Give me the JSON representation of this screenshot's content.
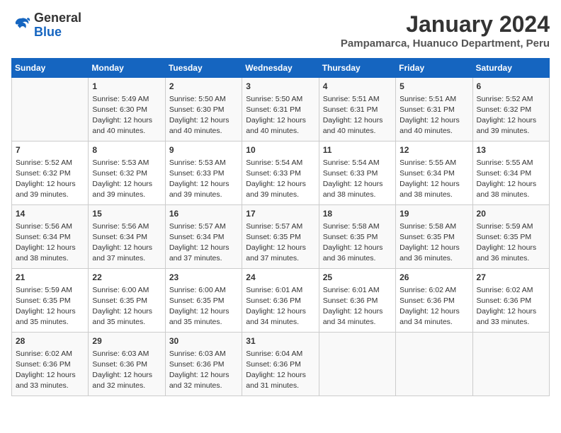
{
  "logo": {
    "general": "General",
    "blue": "Blue"
  },
  "title": {
    "month_year": "January 2024",
    "location": "Pampamarca, Huanuco Department, Peru"
  },
  "days_of_week": [
    "Sunday",
    "Monday",
    "Tuesday",
    "Wednesday",
    "Thursday",
    "Friday",
    "Saturday"
  ],
  "weeks": [
    [
      {
        "day": "",
        "content": ""
      },
      {
        "day": "1",
        "content": "Sunrise: 5:49 AM\nSunset: 6:30 PM\nDaylight: 12 hours\nand 40 minutes."
      },
      {
        "day": "2",
        "content": "Sunrise: 5:50 AM\nSunset: 6:30 PM\nDaylight: 12 hours\nand 40 minutes."
      },
      {
        "day": "3",
        "content": "Sunrise: 5:50 AM\nSunset: 6:31 PM\nDaylight: 12 hours\nand 40 minutes."
      },
      {
        "day": "4",
        "content": "Sunrise: 5:51 AM\nSunset: 6:31 PM\nDaylight: 12 hours\nand 40 minutes."
      },
      {
        "day": "5",
        "content": "Sunrise: 5:51 AM\nSunset: 6:31 PM\nDaylight: 12 hours\nand 40 minutes."
      },
      {
        "day": "6",
        "content": "Sunrise: 5:52 AM\nSunset: 6:32 PM\nDaylight: 12 hours\nand 39 minutes."
      }
    ],
    [
      {
        "day": "7",
        "content": "Sunrise: 5:52 AM\nSunset: 6:32 PM\nDaylight: 12 hours\nand 39 minutes."
      },
      {
        "day": "8",
        "content": "Sunrise: 5:53 AM\nSunset: 6:32 PM\nDaylight: 12 hours\nand 39 minutes."
      },
      {
        "day": "9",
        "content": "Sunrise: 5:53 AM\nSunset: 6:33 PM\nDaylight: 12 hours\nand 39 minutes."
      },
      {
        "day": "10",
        "content": "Sunrise: 5:54 AM\nSunset: 6:33 PM\nDaylight: 12 hours\nand 39 minutes."
      },
      {
        "day": "11",
        "content": "Sunrise: 5:54 AM\nSunset: 6:33 PM\nDaylight: 12 hours\nand 38 minutes."
      },
      {
        "day": "12",
        "content": "Sunrise: 5:55 AM\nSunset: 6:34 PM\nDaylight: 12 hours\nand 38 minutes."
      },
      {
        "day": "13",
        "content": "Sunrise: 5:55 AM\nSunset: 6:34 PM\nDaylight: 12 hours\nand 38 minutes."
      }
    ],
    [
      {
        "day": "14",
        "content": "Sunrise: 5:56 AM\nSunset: 6:34 PM\nDaylight: 12 hours\nand 38 minutes."
      },
      {
        "day": "15",
        "content": "Sunrise: 5:56 AM\nSunset: 6:34 PM\nDaylight: 12 hours\nand 37 minutes."
      },
      {
        "day": "16",
        "content": "Sunrise: 5:57 AM\nSunset: 6:34 PM\nDaylight: 12 hours\nand 37 minutes."
      },
      {
        "day": "17",
        "content": "Sunrise: 5:57 AM\nSunset: 6:35 PM\nDaylight: 12 hours\nand 37 minutes."
      },
      {
        "day": "18",
        "content": "Sunrise: 5:58 AM\nSunset: 6:35 PM\nDaylight: 12 hours\nand 36 minutes."
      },
      {
        "day": "19",
        "content": "Sunrise: 5:58 AM\nSunset: 6:35 PM\nDaylight: 12 hours\nand 36 minutes."
      },
      {
        "day": "20",
        "content": "Sunrise: 5:59 AM\nSunset: 6:35 PM\nDaylight: 12 hours\nand 36 minutes."
      }
    ],
    [
      {
        "day": "21",
        "content": "Sunrise: 5:59 AM\nSunset: 6:35 PM\nDaylight: 12 hours\nand 35 minutes."
      },
      {
        "day": "22",
        "content": "Sunrise: 6:00 AM\nSunset: 6:35 PM\nDaylight: 12 hours\nand 35 minutes."
      },
      {
        "day": "23",
        "content": "Sunrise: 6:00 AM\nSunset: 6:35 PM\nDaylight: 12 hours\nand 35 minutes."
      },
      {
        "day": "24",
        "content": "Sunrise: 6:01 AM\nSunset: 6:36 PM\nDaylight: 12 hours\nand 34 minutes."
      },
      {
        "day": "25",
        "content": "Sunrise: 6:01 AM\nSunset: 6:36 PM\nDaylight: 12 hours\nand 34 minutes."
      },
      {
        "day": "26",
        "content": "Sunrise: 6:02 AM\nSunset: 6:36 PM\nDaylight: 12 hours\nand 34 minutes."
      },
      {
        "day": "27",
        "content": "Sunrise: 6:02 AM\nSunset: 6:36 PM\nDaylight: 12 hours\nand 33 minutes."
      }
    ],
    [
      {
        "day": "28",
        "content": "Sunrise: 6:02 AM\nSunset: 6:36 PM\nDaylight: 12 hours\nand 33 minutes."
      },
      {
        "day": "29",
        "content": "Sunrise: 6:03 AM\nSunset: 6:36 PM\nDaylight: 12 hours\nand 32 minutes."
      },
      {
        "day": "30",
        "content": "Sunrise: 6:03 AM\nSunset: 6:36 PM\nDaylight: 12 hours\nand 32 minutes."
      },
      {
        "day": "31",
        "content": "Sunrise: 6:04 AM\nSunset: 6:36 PM\nDaylight: 12 hours\nand 31 minutes."
      },
      {
        "day": "",
        "content": ""
      },
      {
        "day": "",
        "content": ""
      },
      {
        "day": "",
        "content": ""
      }
    ]
  ]
}
